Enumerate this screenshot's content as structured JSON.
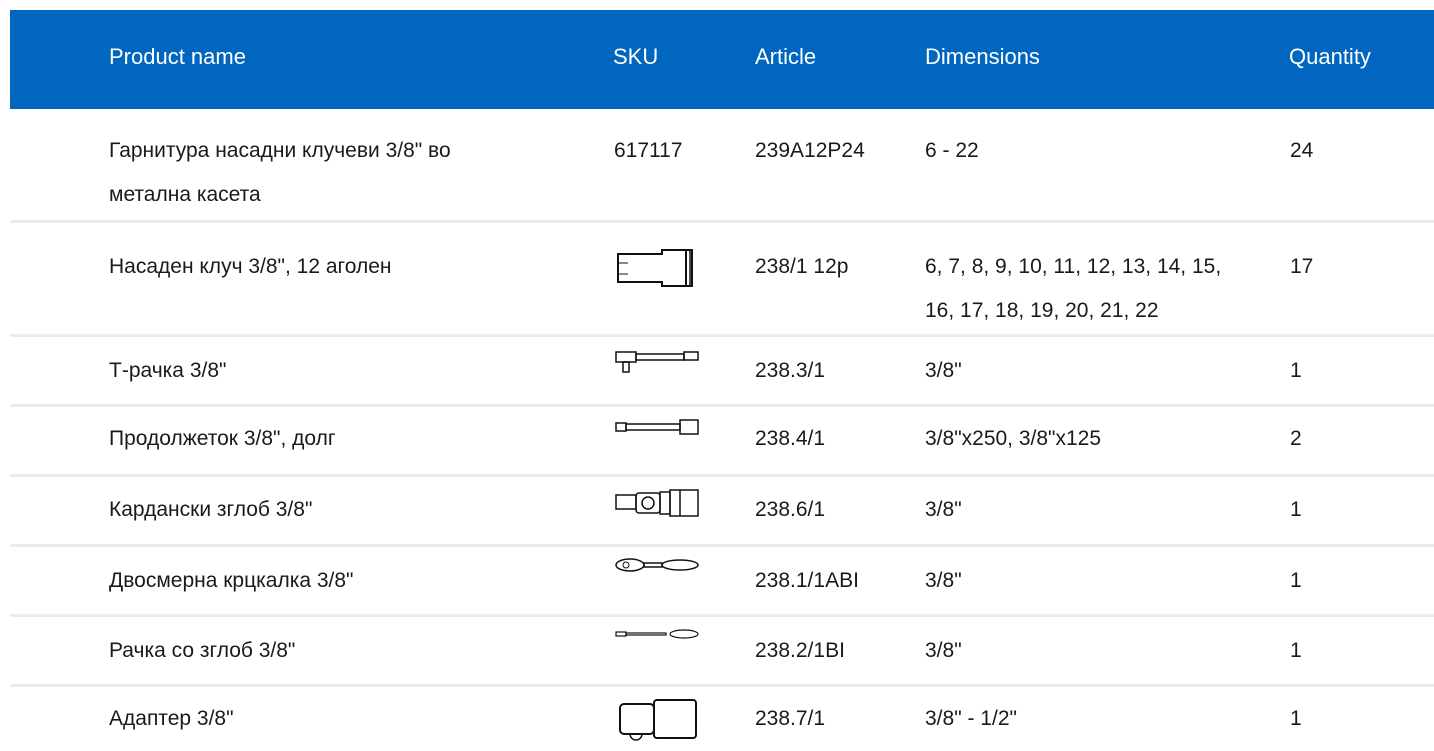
{
  "header": {
    "product_name": "Product name",
    "sku": "SKU",
    "article": "Article",
    "dimensions": "Dimensions",
    "quantity": "Quantity"
  },
  "rows": [
    {
      "name": "Гарнитура насадни клучеви 3/8\" во метална касета",
      "sku": "617117",
      "article": "239A12P24",
      "dimensions": "6 - 22",
      "quantity": "24"
    },
    {
      "name": "Насаден клуч 3/8\", 12 аголен",
      "sku_icon": "socket-icon",
      "article": "238/1 12p",
      "dimensions": "6, 7, 8, 9, 10, 11, 12, 13, 14, 15, 16, 17, 18, 19, 20, 21, 22",
      "quantity": "17"
    },
    {
      "name": "Т-рачка 3/8\"",
      "sku_icon": "t-handle-icon",
      "article": "238.3/1",
      "dimensions": "3/8\"",
      "quantity": "1"
    },
    {
      "name": "Продолжеток 3/8\", долг",
      "sku_icon": "extension-bar-icon",
      "article": "238.4/1",
      "dimensions": "3/8\"x250, 3/8\"x125",
      "quantity": "2"
    },
    {
      "name": "Кардански зглоб 3/8\"",
      "sku_icon": "universal-joint-icon",
      "article": "238.6/1",
      "dimensions": "3/8\"",
      "quantity": "1"
    },
    {
      "name": "Двосмерна крцкалка 3/8\"",
      "sku_icon": "ratchet-icon",
      "article": "238.1/1ABI",
      "dimensions": "3/8\"",
      "quantity": "1"
    },
    {
      "name": "Рачка со зглоб 3/8\"",
      "sku_icon": "hinged-handle-icon",
      "article": "238.2/1BI",
      "dimensions": "3/8\"",
      "quantity": "1"
    },
    {
      "name": "Адаптер 3/8\"",
      "sku_icon": "adapter-icon",
      "article": "238.7/1",
      "dimensions": "3/8\" - 1/2\"",
      "quantity": "1"
    }
  ],
  "colors": {
    "header_bg": "#0066c0",
    "header_text": "#ffffff",
    "row_divider": "#ececec"
  }
}
